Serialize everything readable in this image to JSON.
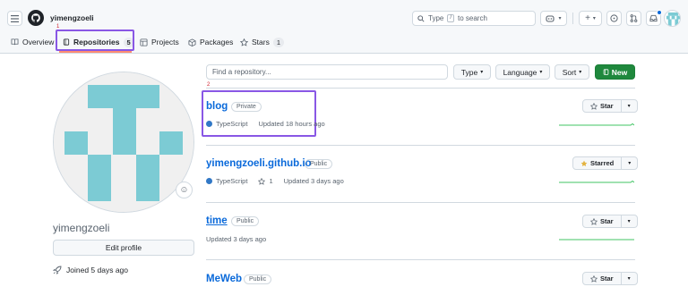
{
  "header": {
    "username": "yimengzoeli",
    "search_placeholder_prefix": "Type",
    "search_key": "/",
    "search_placeholder_suffix": "to search",
    "plus_label": "+"
  },
  "nav": {
    "tabs": [
      {
        "label": "Overview"
      },
      {
        "label": "Repositories",
        "count": "5"
      },
      {
        "label": "Projects"
      },
      {
        "label": "Packages"
      },
      {
        "label": "Stars",
        "count": "1"
      }
    ],
    "annotation_1": "1",
    "annotation_2": "2"
  },
  "profile": {
    "name": "yimengzoeli",
    "edit_label": "Edit profile",
    "joined": "Joined 5 days ago"
  },
  "toolbar": {
    "find_placeholder": "Find a repository...",
    "type_label": "Type",
    "language_label": "Language",
    "sort_label": "Sort",
    "new_label": "New"
  },
  "repos": [
    {
      "name": "blog",
      "visibility": "Private",
      "language": "TypeScript",
      "stars": "",
      "updated": "Updated 18 hours ago",
      "star_label": "Star"
    },
    {
      "name": "yimengzoeli.github.io",
      "visibility": "Public",
      "language": "TypeScript",
      "stars": "1",
      "updated": "Updated 3 days ago",
      "star_label": "Starred"
    },
    {
      "name": "time",
      "visibility": "Public",
      "language": "",
      "stars": "",
      "updated": "Updated 3 days ago",
      "star_label": "Star"
    },
    {
      "name": "MeWeb",
      "visibility": "Public",
      "language": "",
      "stars": "",
      "updated": "",
      "star_label": "Star"
    }
  ],
  "colors": {
    "accent_link": "#0969da",
    "new_button": "#1f883d",
    "highlight": "#8957e5",
    "identicon": "#7ccbd4",
    "typescript": "#3178c6",
    "starred": "#e3b341"
  }
}
